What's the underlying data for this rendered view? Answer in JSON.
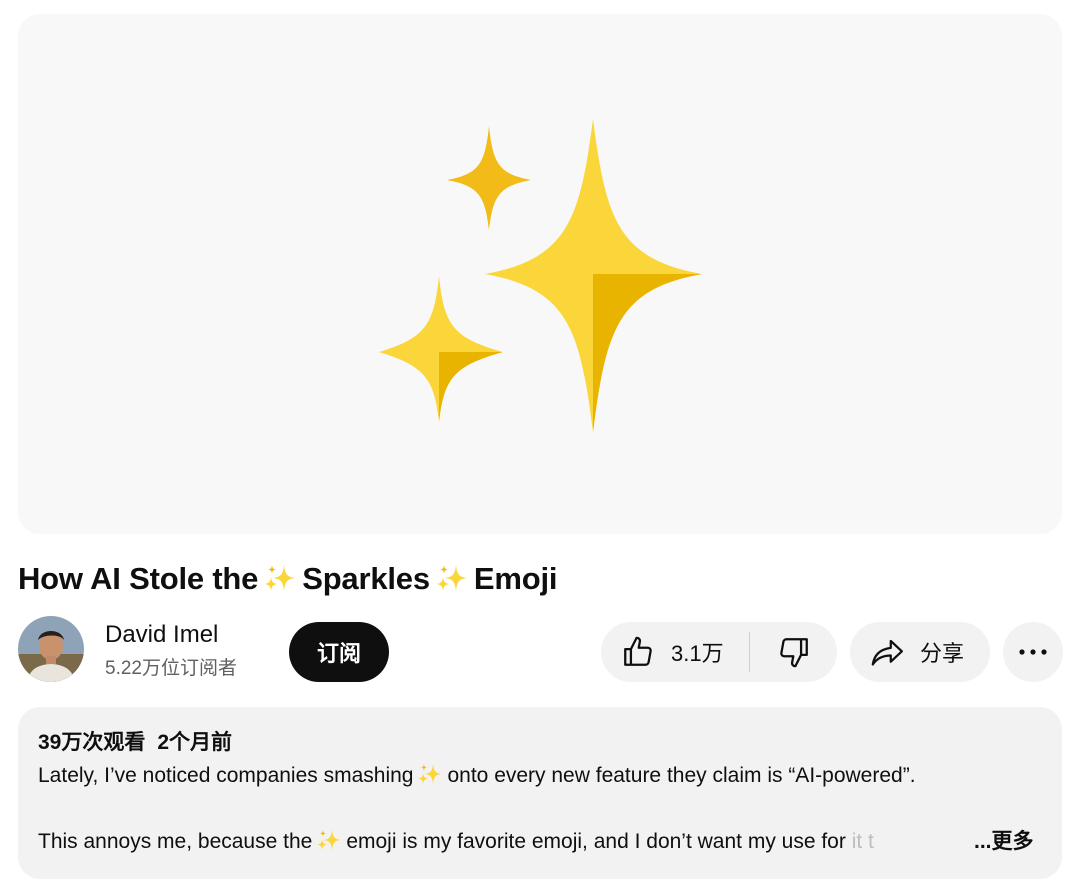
{
  "video": {
    "thumbnail_icon": "sparkles-emoji"
  },
  "title": {
    "part1": "How AI Stole the",
    "part2": "Sparkles",
    "part3": "Emoji"
  },
  "channel": {
    "name": "David Imel",
    "subscribers": "5.22万位订阅者",
    "subscribe_label": "订阅"
  },
  "actions": {
    "like_count": "3.1万",
    "share_label": "分享",
    "like_icon": "thumbs-up-icon",
    "dislike_icon": "thumbs-down-icon",
    "share_icon": "share-arrow-icon",
    "more_icon": "more-horizontal-icon"
  },
  "description": {
    "views": "39万次观看",
    "age": "2个月前",
    "line1_a": "Lately, I’ve noticed companies smashing",
    "line1_b": "onto every new feature they claim is “AI-powered”.",
    "line2_a": "This annoys me, because the",
    "line2_b": "emoji is my favorite emoji, and I don’t want my use for",
    "line2_fade": "it t",
    "more_label": "...更多"
  },
  "colors": {
    "sparkle_gold": "#F5C518",
    "sparkle_shade": "#E8A800",
    "subscribe_bg": "#0F0F0F",
    "pill_bg": "#F2F2F2"
  }
}
